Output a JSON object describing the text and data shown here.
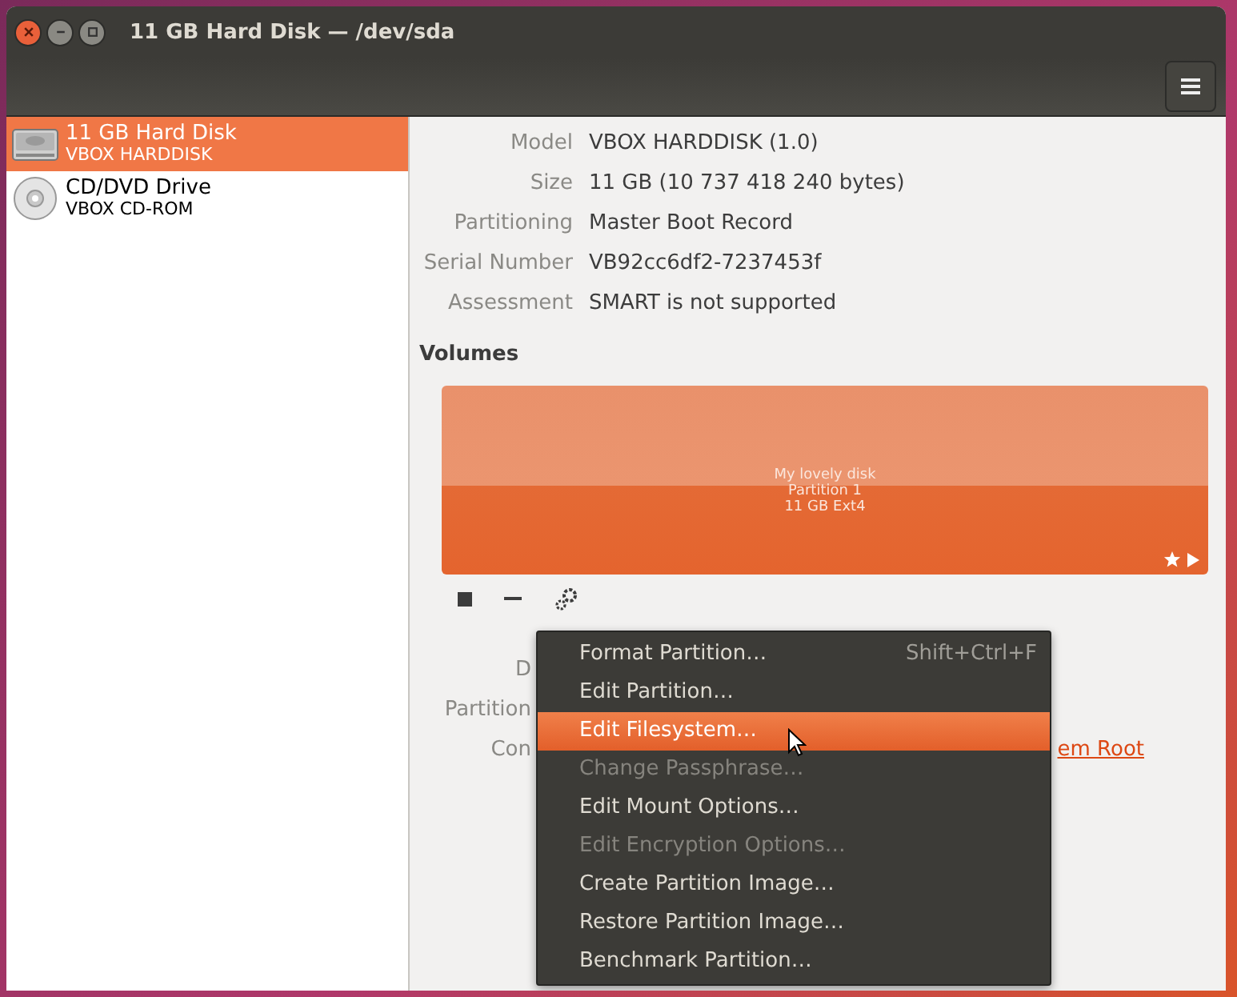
{
  "window": {
    "title": "11 GB Hard Disk — /dev/sda"
  },
  "devices": [
    {
      "kind": "disk",
      "name": "11 GB Hard Disk",
      "model": "VBOX HARDDISK",
      "selected": true
    },
    {
      "kind": "optical",
      "name": "CD/DVD Drive",
      "model": "VBOX CD-ROM",
      "selected": false
    }
  ],
  "details": [
    {
      "label": "Model",
      "value": "VBOX HARDDISK (1.0)"
    },
    {
      "label": "Size",
      "value": "11 GB (10 737 418 240 bytes)"
    },
    {
      "label": "Partitioning",
      "value": "Master Boot Record"
    },
    {
      "label": "Serial Number",
      "value": "VB92cc6df2-7237453f"
    },
    {
      "label": "Assessment",
      "value": "SMART is not supported"
    }
  ],
  "volumes": {
    "heading": "Volumes",
    "segment_lines": [
      "My lovely disk",
      "Partition 1",
      "11 GB Ext4"
    ]
  },
  "partition_details": [
    {
      "label": "D"
    },
    {
      "label": "Partition"
    },
    {
      "label": "Con",
      "value": "em Root"
    }
  ],
  "context_menu": [
    {
      "label": "Format Partition…",
      "shortcut": "Shift+Ctrl+F",
      "disabled": false,
      "selected": false
    },
    {
      "label": "Edit Partition…",
      "disabled": false,
      "selected": false
    },
    {
      "label": "Edit Filesystem…",
      "disabled": false,
      "selected": true
    },
    {
      "label": "Change Passphrase…",
      "disabled": true,
      "selected": false
    },
    {
      "label": "Edit Mount Options…",
      "disabled": false,
      "selected": false
    },
    {
      "label": "Edit Encryption Options…",
      "disabled": true,
      "selected": false
    },
    {
      "label": "Create Partition Image…",
      "disabled": false,
      "selected": false
    },
    {
      "label": "Restore Partition Image…",
      "disabled": false,
      "selected": false
    },
    {
      "label": "Benchmark Partition…",
      "disabled": false,
      "selected": false
    }
  ]
}
